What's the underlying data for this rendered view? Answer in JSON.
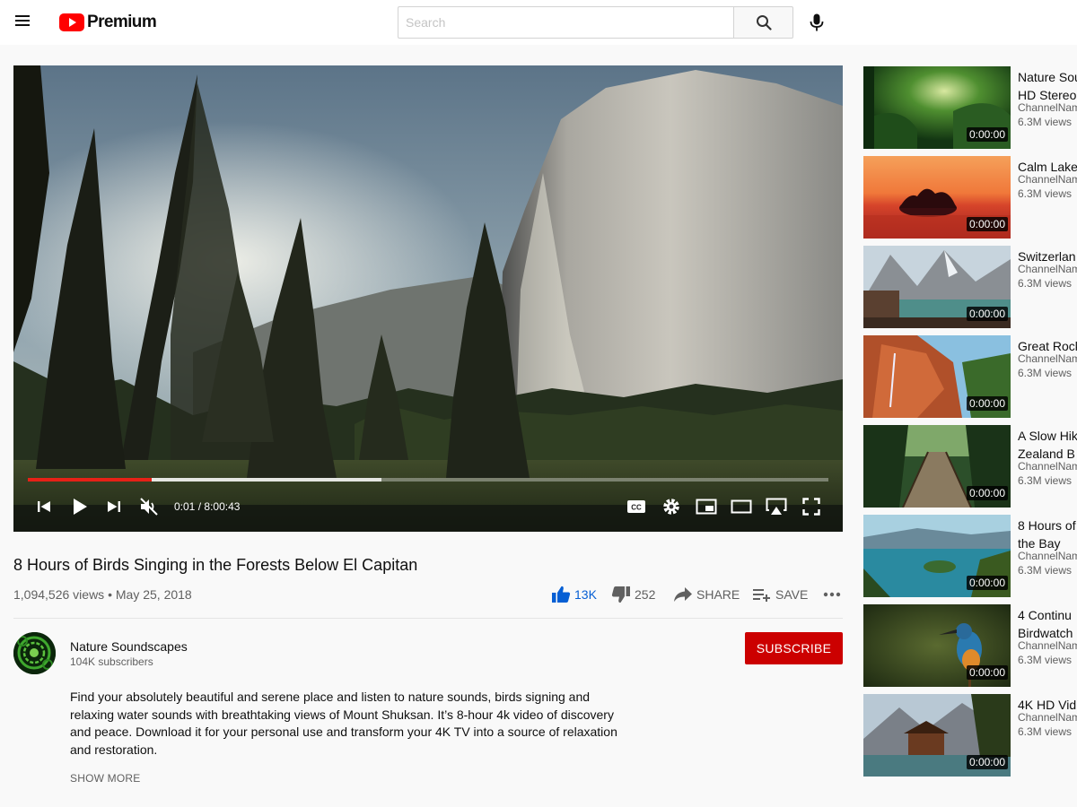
{
  "header": {
    "logo_text": "Premium",
    "search_placeholder": "Search"
  },
  "player": {
    "current_time": "0:01",
    "time_separator": "/",
    "duration": "8:00:43",
    "played_fraction": 0.155,
    "buffered_fraction": 0.442
  },
  "video": {
    "title": "8 Hours of Birds Singing in the Forests Below El Capitan",
    "views": "1,094,526 views",
    "date": "May 25, 2018",
    "likes": "13K",
    "dislikes": "252",
    "share_label": "SHARE",
    "save_label": "SAVE"
  },
  "channel": {
    "name": "Nature Soundscapes",
    "subscribers": "104K subscribers",
    "subscribe_label": "SUBSCRIBE"
  },
  "description": {
    "text": "Find your absolutely beautiful and serene place and listen to nature sounds, birds signing and relaxing water sounds with breathtaking views of Mount Shuksan. It’s 8-hour 4k video of discovery and peace. Download it for your personal use and transform your 4K TV into a source of relaxation and restoration.",
    "show_more": "SHOW MORE"
  },
  "recommendations": [
    {
      "title": "Nature Sou\nHD Stereo",
      "channel": "ChannelName",
      "views": "6.3M views",
      "duration": "0:00:00"
    },
    {
      "title": "Calm Lake",
      "channel": "ChannelName",
      "views": "6.3M views",
      "duration": "0:00:00"
    },
    {
      "title": "Switzerlan",
      "channel": "ChannelName",
      "views": "6.3M views",
      "duration": "0:00:00"
    },
    {
      "title": "Great Rock",
      "channel": "ChannelName",
      "views": "6.3M views",
      "duration": "0:00:00"
    },
    {
      "title": "A Slow Hik\nZealand B",
      "channel": "ChannelName",
      "views": "6.3M views",
      "duration": "0:00:00"
    },
    {
      "title": "8 Hours of\nthe Bay",
      "channel": "ChannelName",
      "views": "6.3M views",
      "duration": "0:00:00"
    },
    {
      "title": "4 Continu\nBirdwatch",
      "channel": "ChannelName",
      "views": "6.3M views",
      "duration": "0:00:00"
    },
    {
      "title": "4K HD Vid",
      "channel": "ChannelName",
      "views": "6.3M views",
      "duration": "0:00:00"
    }
  ],
  "colors": {
    "brand_red": "#ff0000",
    "subscribe_red": "#cc0000",
    "like_blue": "#065fd4",
    "progress_red": "#e62117"
  },
  "icons": [
    "menu-icon",
    "youtube-logo-icon",
    "search-icon",
    "mic-icon",
    "previous-icon",
    "play-icon",
    "next-icon",
    "mute-icon",
    "captions-icon",
    "settings-icon",
    "miniplayer-icon",
    "theater-icon",
    "cast-icon",
    "fullscreen-icon",
    "like-icon",
    "dislike-icon",
    "share-icon",
    "save-playlist-icon",
    "more-icon"
  ]
}
